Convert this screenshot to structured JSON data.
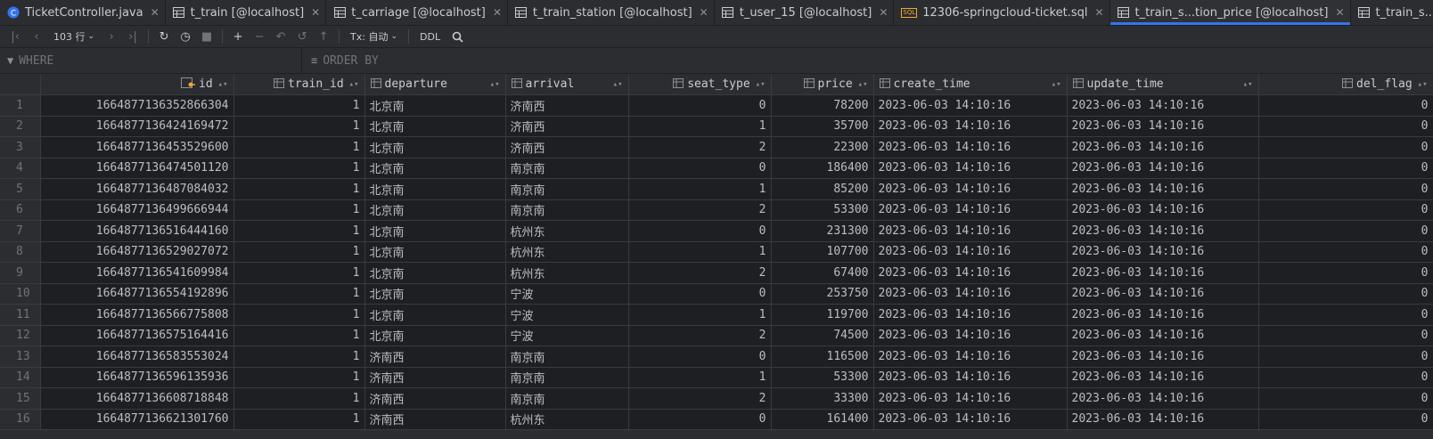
{
  "tabs": [
    {
      "label": "TicketController.java",
      "icon": "java-class-icon",
      "active": false
    },
    {
      "label": "t_train [@localhost]",
      "icon": "table-icon",
      "active": false
    },
    {
      "label": "t_carriage [@localhost]",
      "icon": "table-icon",
      "active": false
    },
    {
      "label": "t_train_station [@localhost]",
      "icon": "table-icon",
      "active": false
    },
    {
      "label": "t_user_15 [@localhost]",
      "icon": "table-icon",
      "active": false
    },
    {
      "label": "12306-springcloud-ticket.sql",
      "icon": "sql-file-icon",
      "active": false
    },
    {
      "label": "t_train_s...tion_price [@localhost]",
      "icon": "table-icon",
      "active": true
    },
    {
      "label": "t_train_s...n_relation [@localhost]",
      "icon": "table-icon",
      "active": false
    }
  ],
  "toolbar": {
    "row_count": "103 行",
    "tx_mode": "Tx: 自动",
    "ddl": "DDL"
  },
  "filters": {
    "where": "WHERE",
    "order_by": "ORDER BY"
  },
  "columns": [
    {
      "name": "id",
      "type": "key"
    },
    {
      "name": "train_id",
      "type": "col"
    },
    {
      "name": "departure",
      "type": "col"
    },
    {
      "name": "arrival",
      "type": "col"
    },
    {
      "name": "seat_type",
      "type": "col"
    },
    {
      "name": "price",
      "type": "col"
    },
    {
      "name": "create_time",
      "type": "col"
    },
    {
      "name": "update_time",
      "type": "col"
    },
    {
      "name": "del_flag",
      "type": "col"
    }
  ],
  "rows": [
    [
      "1",
      "1664877136352866304",
      "1",
      "北京南",
      "济南西",
      "0",
      "78200",
      "2023-06-03 14:10:16",
      "2023-06-03 14:10:16",
      "0"
    ],
    [
      "2",
      "1664877136424169472",
      "1",
      "北京南",
      "济南西",
      "1",
      "35700",
      "2023-06-03 14:10:16",
      "2023-06-03 14:10:16",
      "0"
    ],
    [
      "3",
      "1664877136453529600",
      "1",
      "北京南",
      "济南西",
      "2",
      "22300",
      "2023-06-03 14:10:16",
      "2023-06-03 14:10:16",
      "0"
    ],
    [
      "4",
      "1664877136474501120",
      "1",
      "北京南",
      "南京南",
      "0",
      "186400",
      "2023-06-03 14:10:16",
      "2023-06-03 14:10:16",
      "0"
    ],
    [
      "5",
      "1664877136487084032",
      "1",
      "北京南",
      "南京南",
      "1",
      "85200",
      "2023-06-03 14:10:16",
      "2023-06-03 14:10:16",
      "0"
    ],
    [
      "6",
      "1664877136499666944",
      "1",
      "北京南",
      "南京南",
      "2",
      "53300",
      "2023-06-03 14:10:16",
      "2023-06-03 14:10:16",
      "0"
    ],
    [
      "7",
      "1664877136516444160",
      "1",
      "北京南",
      "杭州东",
      "0",
      "231300",
      "2023-06-03 14:10:16",
      "2023-06-03 14:10:16",
      "0"
    ],
    [
      "8",
      "1664877136529027072",
      "1",
      "北京南",
      "杭州东",
      "1",
      "107700",
      "2023-06-03 14:10:16",
      "2023-06-03 14:10:16",
      "0"
    ],
    [
      "9",
      "1664877136541609984",
      "1",
      "北京南",
      "杭州东",
      "2",
      "67400",
      "2023-06-03 14:10:16",
      "2023-06-03 14:10:16",
      "0"
    ],
    [
      "10",
      "1664877136554192896",
      "1",
      "北京南",
      "宁波",
      "0",
      "253750",
      "2023-06-03 14:10:16",
      "2023-06-03 14:10:16",
      "0"
    ],
    [
      "11",
      "1664877136566775808",
      "1",
      "北京南",
      "宁波",
      "1",
      "119700",
      "2023-06-03 14:10:16",
      "2023-06-03 14:10:16",
      "0"
    ],
    [
      "12",
      "1664877136575164416",
      "1",
      "北京南",
      "宁波",
      "2",
      "74500",
      "2023-06-03 14:10:16",
      "2023-06-03 14:10:16",
      "0"
    ],
    [
      "13",
      "1664877136583553024",
      "1",
      "济南西",
      "南京南",
      "0",
      "116500",
      "2023-06-03 14:10:16",
      "2023-06-03 14:10:16",
      "0"
    ],
    [
      "14",
      "1664877136596135936",
      "1",
      "济南西",
      "南京南",
      "1",
      "53300",
      "2023-06-03 14:10:16",
      "2023-06-03 14:10:16",
      "0"
    ],
    [
      "15",
      "1664877136608718848",
      "1",
      "济南西",
      "南京南",
      "2",
      "33300",
      "2023-06-03 14:10:16",
      "2023-06-03 14:10:16",
      "0"
    ],
    [
      "16",
      "1664877136621301760",
      "1",
      "济南西",
      "杭州东",
      "0",
      "161400",
      "2023-06-03 14:10:16",
      "2023-06-03 14:10:16",
      "0"
    ]
  ],
  "colors": {
    "accent": "#3574f0",
    "background": "#1e1f22",
    "chrome": "#2b2d30"
  }
}
